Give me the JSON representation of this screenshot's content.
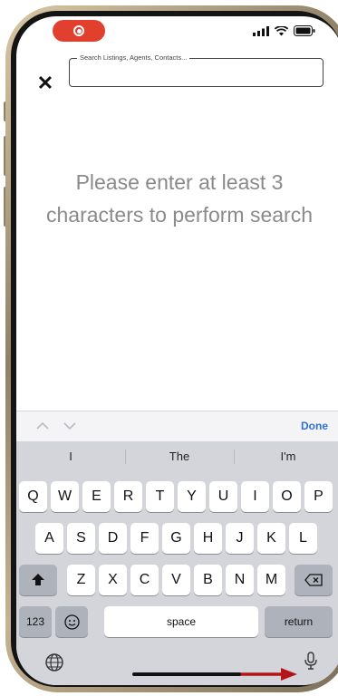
{
  "search": {
    "placeholder": "Search Listings, Agents, Contacts..."
  },
  "header": {
    "close_label": "✕"
  },
  "main": {
    "empty_message": "Please enter at least 3 characters to perform search"
  },
  "accessory": {
    "done_label": "Done"
  },
  "keyboard": {
    "suggestions": [
      "I",
      "The",
      "I'm"
    ],
    "row1": [
      "Q",
      "W",
      "E",
      "R",
      "T",
      "Y",
      "U",
      "I",
      "O",
      "P"
    ],
    "row2": [
      "A",
      "S",
      "D",
      "F",
      "G",
      "H",
      "J",
      "K",
      "L"
    ],
    "row3": [
      "Z",
      "X",
      "C",
      "V",
      "B",
      "N",
      "M"
    ],
    "numbers_label": "123",
    "space_label": "space",
    "return_label": "return"
  },
  "colors": {
    "record": "#e2402f",
    "done": "#2e6fd8",
    "annotation_arrow": "#b3141b"
  }
}
